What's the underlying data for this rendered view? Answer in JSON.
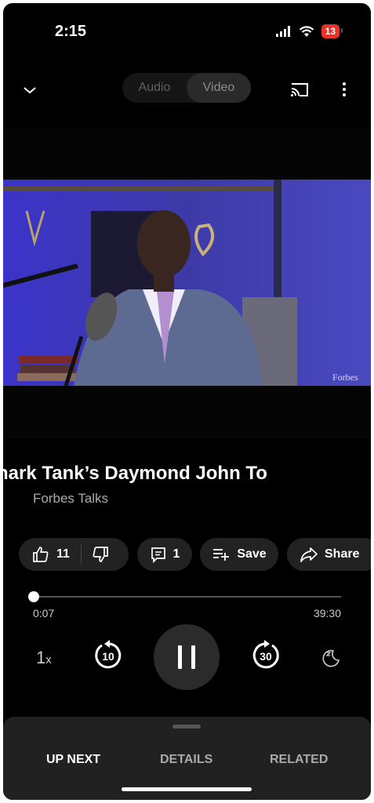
{
  "status": {
    "time": "2:15",
    "battery": "13"
  },
  "mode_toggle": {
    "audio_label": "Audio",
    "video_label": "Video",
    "active": "video"
  },
  "video": {
    "watermark": "Forbes"
  },
  "title": "hark Tank’s Daymond John To",
  "channel": "Forbes Talks",
  "actions": {
    "like_count": "11",
    "comment_count": "1",
    "save_label": "Save",
    "share_label": "Share"
  },
  "playback": {
    "current_time": "0:07",
    "duration": "39:30",
    "progress_fraction": 0.003,
    "speed_value": "1",
    "speed_unit": "x",
    "rewind_seconds": "10",
    "forward_seconds": "30"
  },
  "tabs": {
    "up_next": "UP NEXT",
    "details": "DETAILS",
    "related": "RELATED"
  },
  "colors": {
    "background": "#000000",
    "accent": "#ffffff",
    "battery_low": "#e5332a"
  }
}
